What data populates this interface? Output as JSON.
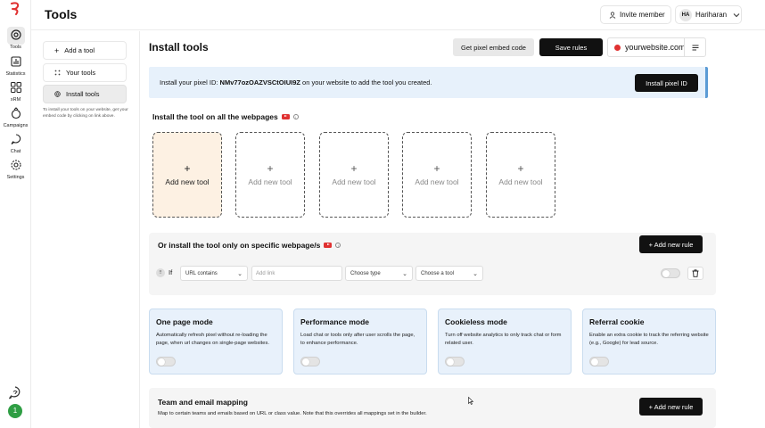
{
  "rail": {
    "items": [
      {
        "label": "Tools",
        "icon": "tools-icon"
      },
      {
        "label": "Statistics",
        "icon": "bar-chart-icon"
      },
      {
        "label": "xRM",
        "icon": "grid-icon"
      },
      {
        "label": "Campaigns",
        "icon": "megaphone-icon"
      },
      {
        "label": "Chat",
        "icon": "chat-icon"
      },
      {
        "label": "Settings",
        "icon": "gear-icon"
      }
    ],
    "avatar": "1"
  },
  "header": {
    "title": "Tools",
    "invite_label": "Invite member",
    "user_initials": "HA",
    "user_name": "Hariharan"
  },
  "subnav": {
    "items": [
      {
        "label": "Add a tool",
        "icon": "plus-icon"
      },
      {
        "label": "Your tools",
        "icon": "dots-grid-icon"
      },
      {
        "label": "Install tools",
        "icon": "globe-icon"
      }
    ],
    "hint": "To install your tools on your website, get your embed code by clicking on link above."
  },
  "main": {
    "title": "Install tools",
    "embed_label": "Get pixel embed code",
    "save_label": "Save rules",
    "site": "yourwebsite.com",
    "banner_prefix": "Install your pixel ID: ",
    "pixel_id": "NMv77ozOAZVSCtOIUI9Z",
    "banner_suffix": " on your website to add the tool you created.",
    "install_pixel_label": "Install pixel ID",
    "all_pages_title": "Install the tool on all the webpages",
    "add_tool_label": "Add new tool",
    "specific_title": "Or install the tool only on specific webpage/s",
    "add_rule_label": "+ Add new rule",
    "rule": {
      "if_label": "If",
      "condition": "URL contains",
      "link_placeholder": "Add link",
      "type": "Choose type",
      "tool": "Choose a tool"
    },
    "modes": [
      {
        "title": "One page mode",
        "desc": "Automatically refresh pixel without re-loading the page, when url changes on single-page websites."
      },
      {
        "title": "Performance mode",
        "desc": "Load chat or tools only after user scrolls the page, to enhance performance."
      },
      {
        "title": "Cookieless mode",
        "desc": "Turn off website analytics to only track chat or form related user."
      },
      {
        "title": "Referral cookie",
        "desc": "Enable an extra cookie to track the referring website (e.g., Google) for lead source."
      }
    ],
    "team_title": "Team and email mapping",
    "team_desc": "Map to certain teams and emails based on URL or class value. Note that this overrides all mappings set in the builder.",
    "team_add_label": "+ Add new rule"
  },
  "colors": {
    "accent_dark": "#111111",
    "banner_bg": "#e7f1fb",
    "mode_bg": "#e8f1fb",
    "first_card_bg": "#fdf1e3",
    "brand_red": "#e03131",
    "avatar_green": "#2f9e44"
  }
}
